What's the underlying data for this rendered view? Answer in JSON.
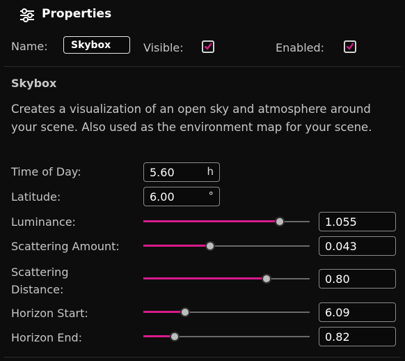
{
  "header": {
    "title": "Properties",
    "icon": "sliders-icon"
  },
  "general": {
    "name_label": "Name:",
    "name_value": "Skybox",
    "visible_label": "Visible:",
    "visible_checked": true,
    "enabled_label": "Enabled:",
    "enabled_checked": true
  },
  "section": {
    "title": "Skybox",
    "description": "Creates a visualization of an open sky and atmosphere around your scene. Also used as the environment map for your scene."
  },
  "fields": {
    "time_of_day": {
      "label": "Time of Day:",
      "value": "5.60",
      "unit": "h"
    },
    "latitude": {
      "label": "Latitude:",
      "value": "6.00",
      "unit": "°"
    }
  },
  "sliders": [
    {
      "label": "Luminance:",
      "value": "1.055",
      "position": 0.82
    },
    {
      "label": "Scattering Amount:",
      "value": "0.043",
      "position": 0.4
    },
    {
      "label": "Scattering Distance:",
      "value": "0.80",
      "position": 0.74
    },
    {
      "label": "Horizon Start:",
      "value": "6.09",
      "position": 0.25
    },
    {
      "label": "Horizon End:",
      "value": "0.82",
      "position": 0.19
    }
  ],
  "colors": {
    "accent": "#d81b8a",
    "background": "#0d0d0d",
    "text": "#c6c6c6"
  }
}
